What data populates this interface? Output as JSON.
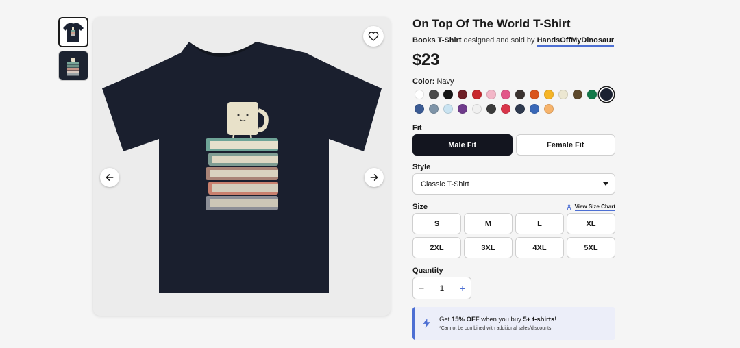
{
  "product": {
    "title": "On Top Of The World T-Shirt",
    "byline": {
      "product_type": "Books T-Shirt",
      "middle": " designed and sold by ",
      "artist": "HandsOffMyDinosaur"
    },
    "price": "$23"
  },
  "color": {
    "label": "Color:",
    "selected": "Navy",
    "swatches": [
      "#ffffff",
      "#4a4a4a",
      "#161616",
      "#6e1f26",
      "#c8282e",
      "#f3b7c8",
      "#e2578a",
      "#3b3330",
      "#d9551d",
      "#f6b526",
      "#ece7d1",
      "#5e4a2c",
      "#137a4a",
      "#1b2232",
      "#3a5a93",
      "#7e94a8",
      "#c9e3f1",
      "#6f3b8c",
      "#f0f0f0",
      "#3b3b3b",
      "#d9354a",
      "#2f3a4f",
      "#3968b8",
      "#f6b36b"
    ],
    "selected_index": 13
  },
  "fit": {
    "label": "Fit",
    "options": [
      "Male Fit",
      "Female Fit"
    ],
    "selected_index": 0
  },
  "style": {
    "label": "Style",
    "value": "Classic T-Shirt"
  },
  "size": {
    "label": "Size",
    "chart_link": "View Size Chart",
    "options": [
      "S",
      "M",
      "L",
      "XL",
      "2XL",
      "3XL",
      "4XL",
      "5XL"
    ]
  },
  "quantity": {
    "label": "Quantity",
    "minus": "−",
    "value": "1",
    "plus": "+"
  },
  "promo": {
    "prefix": "Get ",
    "discount": "15% OFF",
    "middle": " when you buy ",
    "threshold": "5+ t-shirts",
    "suffix": "!",
    "note": "*Cannot be combined with additional sales/discounts."
  },
  "icons": {
    "favorite": "heart-icon",
    "previous": "arrow-left-icon",
    "next": "arrow-right-icon",
    "size_chart": "person-icon",
    "promo": "lightning-icon",
    "select": "caret-down-icon"
  }
}
